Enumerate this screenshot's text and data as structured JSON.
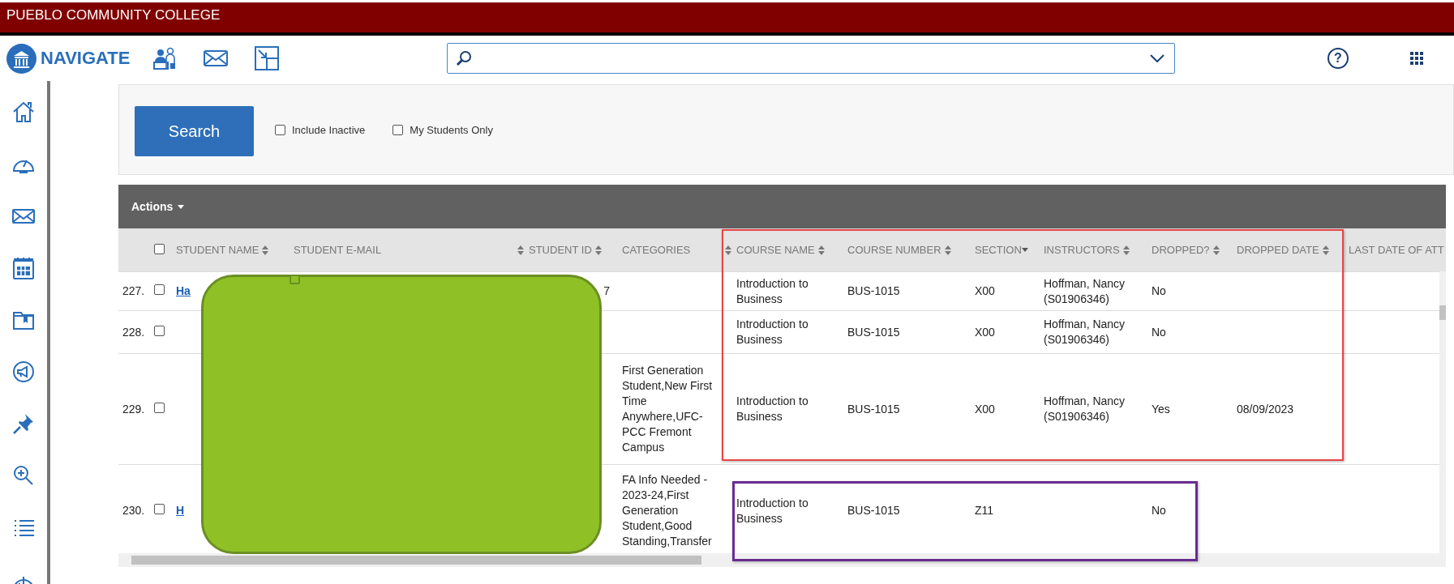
{
  "banner": {
    "title": "PUEBLO COMMUNITY COLLEGE"
  },
  "topnav": {
    "app_name": "NAVIGATE",
    "help": "?"
  },
  "search_panel": {
    "button": "Search",
    "options": [
      {
        "label": "Include Inactive",
        "checked": false
      },
      {
        "label": "My Students Only",
        "checked": false
      }
    ]
  },
  "actions": {
    "label": "Actions"
  },
  "table": {
    "select_all": {
      "checked": false
    },
    "columns": [
      {
        "label": "STUDENT NAME",
        "sortable": true,
        "sorted_descending": false
      },
      {
        "label": "STUDENT E-MAIL",
        "sortable": true,
        "sorted_descending": false
      },
      {
        "label": "STUDENT ID",
        "sortable": true,
        "sorted_descending": false
      },
      {
        "label": "CATEGORIES",
        "sortable": true,
        "sorted_descending": false
      },
      {
        "label": "COURSE NAME",
        "sortable": true,
        "sorted_descending": false
      },
      {
        "label": "COURSE NUMBER",
        "sortable": true,
        "sorted_descending": false
      },
      {
        "label": "SECTION",
        "sortable": true,
        "sorted_descending": true
      },
      {
        "label": "INSTRUCTORS",
        "sortable": true,
        "sorted_descending": false
      },
      {
        "label": "DROPPED?",
        "sortable": true,
        "sorted_descending": false
      },
      {
        "label": "DROPPED DATE",
        "sortable": true,
        "sorted_descending": false
      },
      {
        "label": "LAST DATE OF ATT",
        "sortable": false
      }
    ],
    "rows": [
      {
        "number": "227.",
        "checked": false,
        "name": "Ha",
        "student_id": "7",
        "course_name": "Introduction to Business",
        "course_number": "BUS-1015",
        "section": "X00",
        "instructors": "Hoffman, Nancy (S01906346)",
        "dropped": "No"
      },
      {
        "number": "228.",
        "checked": false,
        "course_name": "Introduction to Business",
        "course_number": "BUS-1015",
        "section": "X00",
        "instructors": "Hoffman, Nancy (S01906346)",
        "dropped": "No"
      },
      {
        "number": "229.",
        "checked": false,
        "categories": "First Generation Student,New First Time Anywhere,UFC-PCC Fremont Campus",
        "course_name": "Introduction to Business",
        "course_number": "BUS-1015",
        "section": "X00",
        "instructors": "Hoffman, Nancy (S01906346)",
        "dropped": "Yes",
        "dropped_date": "08/09/2023"
      },
      {
        "number": "230.",
        "checked": false,
        "name": "H",
        "categories": "FA Info Needed - 2023-24,First Generation Student,Good Standing,Transfer",
        "course_name": "Introduction to Business",
        "course_number": "BUS-1015",
        "section": "Z11",
        "dropped": "No"
      }
    ]
  },
  "annotations": [
    {
      "kind": "box",
      "color": "#e84545"
    },
    {
      "kind": "box",
      "color": "#6a2c91"
    }
  ]
}
